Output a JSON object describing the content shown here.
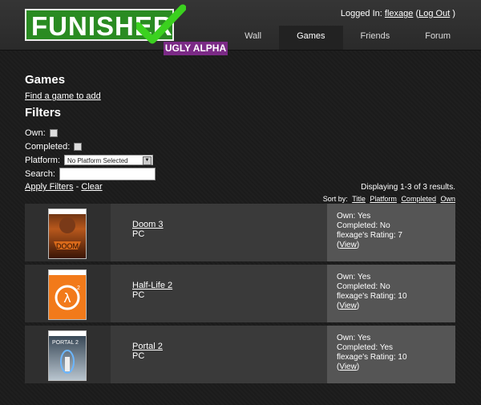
{
  "logo": {
    "text": "FUNISHER",
    "badge": "UGLY ALPHA"
  },
  "login": {
    "prefix": "Logged In:",
    "user": "flexage",
    "open": "(",
    "logout": "Log Out",
    "close": ")"
  },
  "nav": [
    "Wall",
    "Games",
    "Friends",
    "Forum"
  ],
  "page": {
    "title": "Games",
    "find_link": "Find a game to add",
    "filters_title": "Filters",
    "own_label": "Own:",
    "completed_label": "Completed:",
    "platform_label": "Platform:",
    "platform_value": "No Platform Selected",
    "search_label": "Search:",
    "search_value": "",
    "apply_link": "Apply Filters",
    "separator": "-",
    "clear_link": "Clear"
  },
  "results": {
    "count_text": "Displaying 1-3 of 3 results.",
    "sort_label": "Sort by:",
    "sort_options": [
      "Title",
      "Platform",
      "Completed",
      "Own"
    ]
  },
  "games": [
    {
      "title": "Doom 3",
      "platform": "PC",
      "own": "Own: Yes",
      "completed": "Completed: No",
      "rating": "flexage's Rating: 7",
      "view": "View",
      "cover": "doom-cover"
    },
    {
      "title": "Half-Life 2",
      "platform": "PC",
      "own": "Own: Yes",
      "completed": "Completed: No",
      "rating": "flexage's Rating: 10",
      "view": "View",
      "cover": "halflife-cover"
    },
    {
      "title": "Portal 2",
      "platform": "PC",
      "own": "Own: Yes",
      "completed": "Completed: Yes",
      "rating": "flexage's Rating: 10",
      "view": "View",
      "cover": "portal-cover"
    }
  ],
  "colors": {
    "accent_green": "#2a8b22",
    "badge_purple": "#7b2a86"
  }
}
